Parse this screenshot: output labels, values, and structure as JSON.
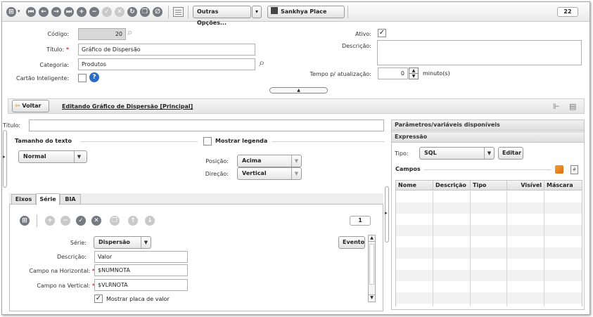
{
  "toolbar": {
    "more_options_label": "Outras Opções...",
    "sankhya_place_label": "Sankhya Place",
    "record_counter": "22"
  },
  "form": {
    "codigo_label": "Código:",
    "codigo_value": "20",
    "titulo_label": "Título:",
    "titulo_value": "Gráfico de Dispersão",
    "categoria_label": "Categoria:",
    "categoria_value": "Produtos",
    "cartao_label": "Cartão Inteligente:",
    "ativo_label": "Ativo:",
    "descricao_label": "Descrição:",
    "tempo_label": "Tempo p/ atualização:",
    "tempo_value": "0",
    "tempo_unit": "minuto(s)"
  },
  "nav": {
    "back_label": "Voltar",
    "editing_title": "Editando Gráfico de Dispersão [Principal]"
  },
  "chart_settings": {
    "titulo_label": "Título:",
    "titulo_value": "",
    "text_size_label": "Tamanho do texto",
    "text_size_value": "Normal",
    "show_legend_label": "Mostrar legenda",
    "position_label": "Posição:",
    "position_value": "Acima",
    "direction_label": "Direção:",
    "direction_value": "Vertical"
  },
  "tabs": [
    "Eixos",
    "Série",
    "BIA"
  ],
  "series": {
    "counter": "1",
    "evento_label": "Evento",
    "serie_label": "Série:",
    "serie_value": "Dispersão",
    "descricao_label": "Descrição:",
    "descricao_value": "Valor",
    "horizontal_label": "Campo na Horizontal:",
    "horizontal_value": "$NUMNOTA",
    "vertical_label": "Campo na Vertical:",
    "vertical_value": "$VLRNOTA",
    "show_value_label": "Mostrar placa de valor"
  },
  "params": {
    "header": "Parâmetros/variáveis disponíveis",
    "expression_header": "Expressão",
    "tipo_label": "Tipo:",
    "tipo_value": "SQL",
    "edit_label": "Editar",
    "fields_label": "Campos",
    "columns": [
      "Nome",
      "Descrição",
      "Tipo",
      "Visível",
      "Máscara"
    ]
  }
}
